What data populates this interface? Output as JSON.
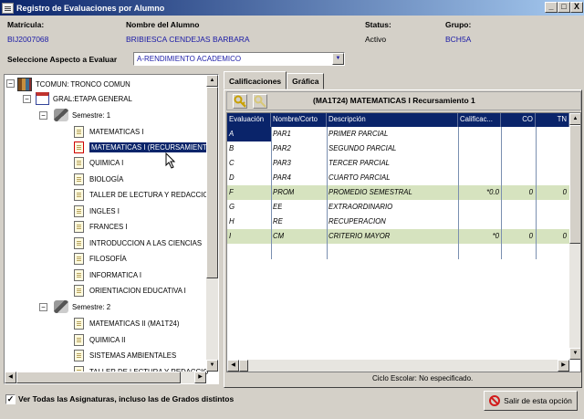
{
  "window": {
    "title": "Registro de Evaluaciones por Alumno",
    "buttons": [
      "_",
      "□",
      "X"
    ]
  },
  "student": {
    "matricula_label": "Matrícula:",
    "matricula": "BIJ2007068",
    "nombre_label": "Nombre del Alumno",
    "nombre": "BRIBIESCA CENDEJAS BARBARA",
    "status_label": "Status:",
    "status": "Activo",
    "grupo_label": "Grupo:",
    "grupo": "BCH5A"
  },
  "aspect": {
    "label": "Seleccione Aspecto a Evaluar",
    "value": "A-RENDIMIENTO ACADEMICO"
  },
  "tree": {
    "root": "TCOMUN: TRONCO COMUN",
    "stage": "GRAL:ETAPA GENERAL",
    "semester1": "Semestre: 1",
    "sem1_items": [
      "MATEMATICAS I",
      "MATEMATICAS I (RECURSAMIENT",
      "QUIMICA I",
      "BIOLOGÍA",
      "TALLER DE LECTURA Y REDACCIO",
      "INGLES I",
      "FRANCES I",
      "INTRODUCCION A LAS CIENCIAS",
      "FILOSOFÍA",
      "INFORMATICA I",
      "ORIENTIACION EDUCATIVA I"
    ],
    "semester2": "Semestre: 2",
    "sem2_items": [
      "MATEMATICAS II (MA1T24)",
      "QUIMICA II",
      "SISTEMAS AMBIENTALES",
      "TALLER DE LECTURA Y REDACCIO"
    ]
  },
  "tabs": [
    "Calificaciones",
    "Gráfica"
  ],
  "subject_header": "(MA1T24) MATEMATICAS I Recursamiento 1",
  "grid": {
    "columns": [
      "Evaluación",
      "Nombre/Corto",
      "Descripción",
      "Calificac...",
      "CO",
      "TN"
    ],
    "rows": [
      {
        "eval": "A",
        "short": "PAR1",
        "desc": "PRIMER PARCIAL",
        "cal": "",
        "co": "",
        "tn": ""
      },
      {
        "eval": "B",
        "short": "PAR2",
        "desc": "SEGUNDO PARCIAL",
        "cal": "",
        "co": "",
        "tn": ""
      },
      {
        "eval": "C",
        "short": "PAR3",
        "desc": "TERCER PARCIAL",
        "cal": "",
        "co": "",
        "tn": ""
      },
      {
        "eval": "D",
        "short": "PAR4",
        "desc": "CUARTO PARCIAL",
        "cal": "",
        "co": "",
        "tn": ""
      },
      {
        "eval": "F",
        "short": "PROM",
        "desc": "PROMEDIO SEMESTRAL",
        "cal": "*0.0",
        "co": "0",
        "tn": "0"
      },
      {
        "eval": "G",
        "short": "EE",
        "desc": "EXTRAORDINARIO",
        "cal": "",
        "co": "",
        "tn": ""
      },
      {
        "eval": "H",
        "short": "RE",
        "desc": "RECUPERACION",
        "cal": "",
        "co": "",
        "tn": ""
      },
      {
        "eval": "I",
        "short": "CM",
        "desc": "CRITERIO MAYOR",
        "cal": "*0",
        "co": "0",
        "tn": "0"
      }
    ]
  },
  "status_bar": "Ciclo Escolar: No especificado.",
  "footer": {
    "checkbox_label": "Ver Todas las Asignaturas, incluso las de Grados distintos",
    "checked": true,
    "exit_label": "Salir de esta opción"
  }
}
